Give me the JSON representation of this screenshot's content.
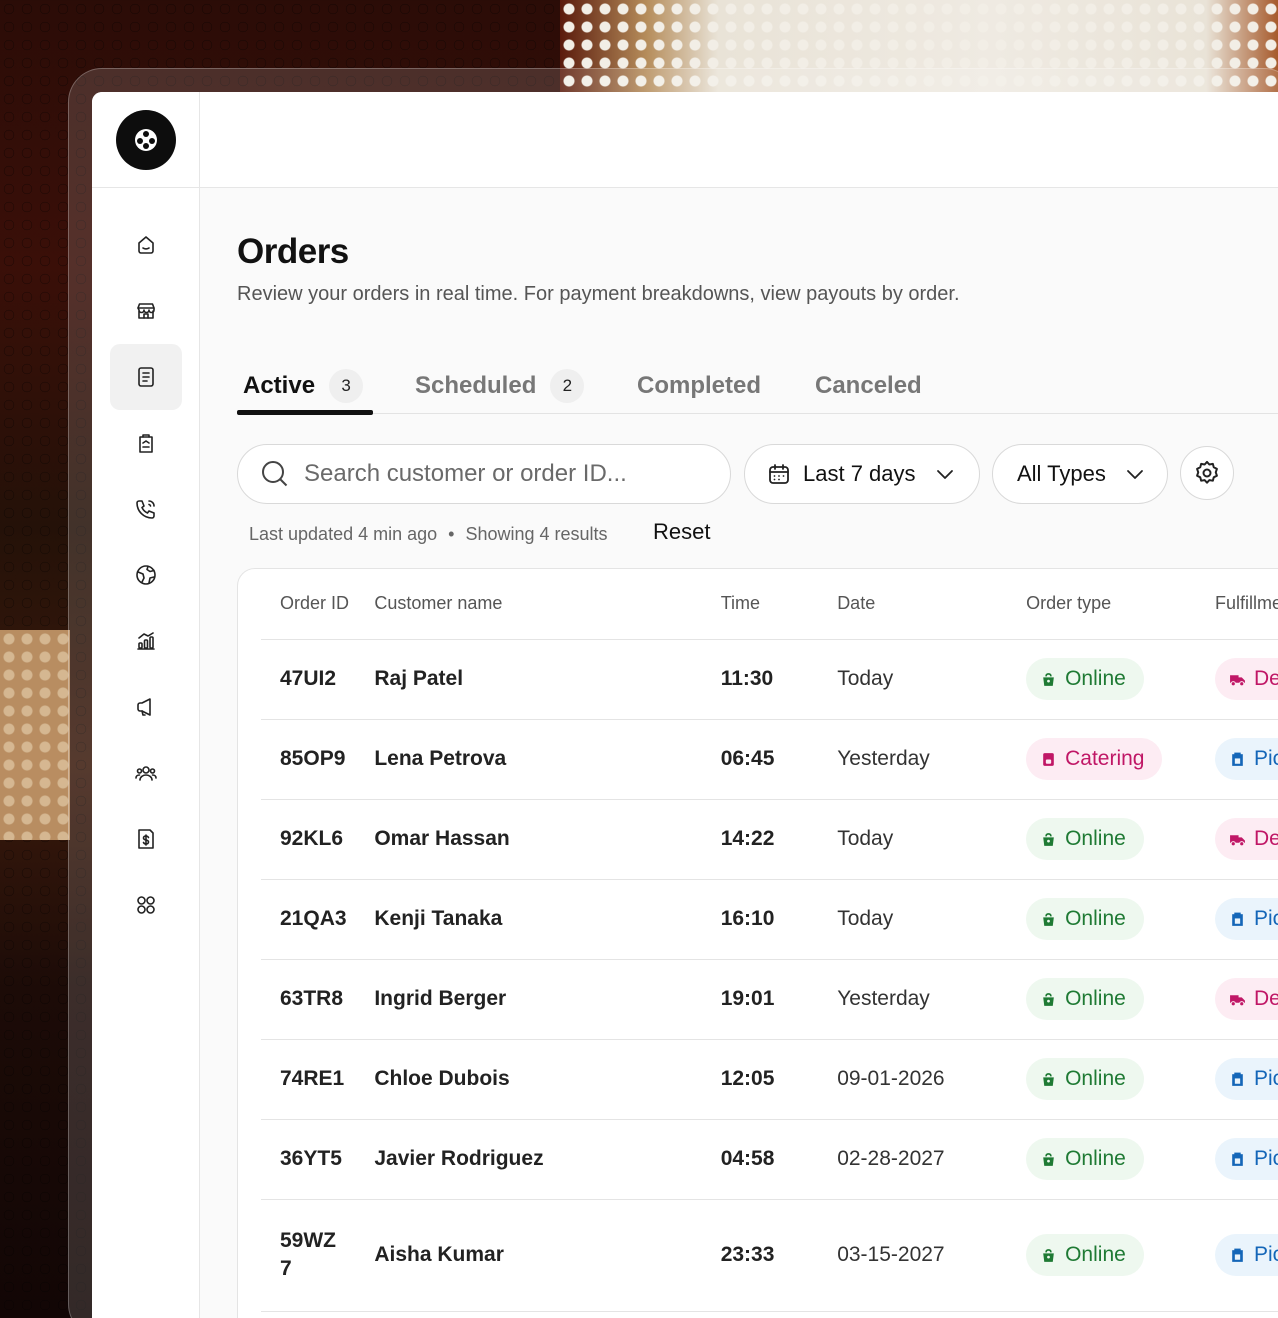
{
  "page": {
    "title": "Orders",
    "subtitle": "Review your orders in real time. For payment breakdowns, view payouts by order."
  },
  "tabs": [
    {
      "label": "Active",
      "count": "3"
    },
    {
      "label": "Scheduled",
      "count": "2"
    },
    {
      "label": "Completed"
    },
    {
      "label": "Canceled"
    }
  ],
  "filters": {
    "search_placeholder": "Search customer or order ID...",
    "date_range": "Last 7 days",
    "type_filter": "All Types"
  },
  "meta": {
    "updated": "Last updated 4 min ago",
    "separator": "•",
    "results": "Showing 4 results",
    "reset_label": "Reset"
  },
  "table": {
    "headers": [
      "Order ID",
      "Customer name",
      "Time",
      "Date",
      "Order type",
      "Fulfillment"
    ],
    "rows": [
      {
        "id": "47UI2",
        "name": "Raj Patel",
        "time": "11:30",
        "date": "Today",
        "type": "Online",
        "fulfillment": "Deliv"
      },
      {
        "id": "85OP9",
        "name": "Lena Petrova",
        "time": "06:45",
        "date": "Yesterday",
        "type": "Catering",
        "fulfillment": "Picku"
      },
      {
        "id": "92KL6",
        "name": "Omar Hassan",
        "time": "14:22",
        "date": "Today",
        "type": "Online",
        "fulfillment": "Deliv"
      },
      {
        "id": "21QA3",
        "name": "Kenji Tanaka",
        "time": "16:10",
        "date": "Today",
        "type": "Online",
        "fulfillment": "Picku"
      },
      {
        "id": "63TR8",
        "name": "Ingrid Berger",
        "time": "19:01",
        "date": "Yesterday",
        "type": "Online",
        "fulfillment": "Deliv"
      },
      {
        "id": "74RE1",
        "name": "Chloe Dubois",
        "time": "12:05",
        "date": "09-01-2026",
        "type": "Online",
        "fulfillment": "Picku"
      },
      {
        "id": "36YT5",
        "name": "Javier Rodriguez",
        "time": "04:58",
        "date": "02-28-2027",
        "type": "Online",
        "fulfillment": "Picku"
      },
      {
        "id": "59WZ 7",
        "name": "Aisha Kumar",
        "time": "23:33",
        "date": "03-15-2027",
        "type": "Online",
        "fulfillment": "Picku"
      }
    ]
  },
  "sidebar": {
    "icons": [
      "home-icon",
      "store-icon",
      "orders-icon",
      "menu-icon",
      "phone-icon",
      "globe-icon",
      "analytics-icon",
      "megaphone-icon",
      "customers-icon",
      "payouts-icon",
      "apps-icon"
    ],
    "active": "orders-icon"
  },
  "colors": {
    "online_bg": "#eef8ef",
    "online_fg": "#1f7a34",
    "pink_bg": "#fdecf3",
    "pink_fg": "#c01766",
    "pickup_bg": "#eaf4fc",
    "pickup_fg": "#1466b8"
  }
}
